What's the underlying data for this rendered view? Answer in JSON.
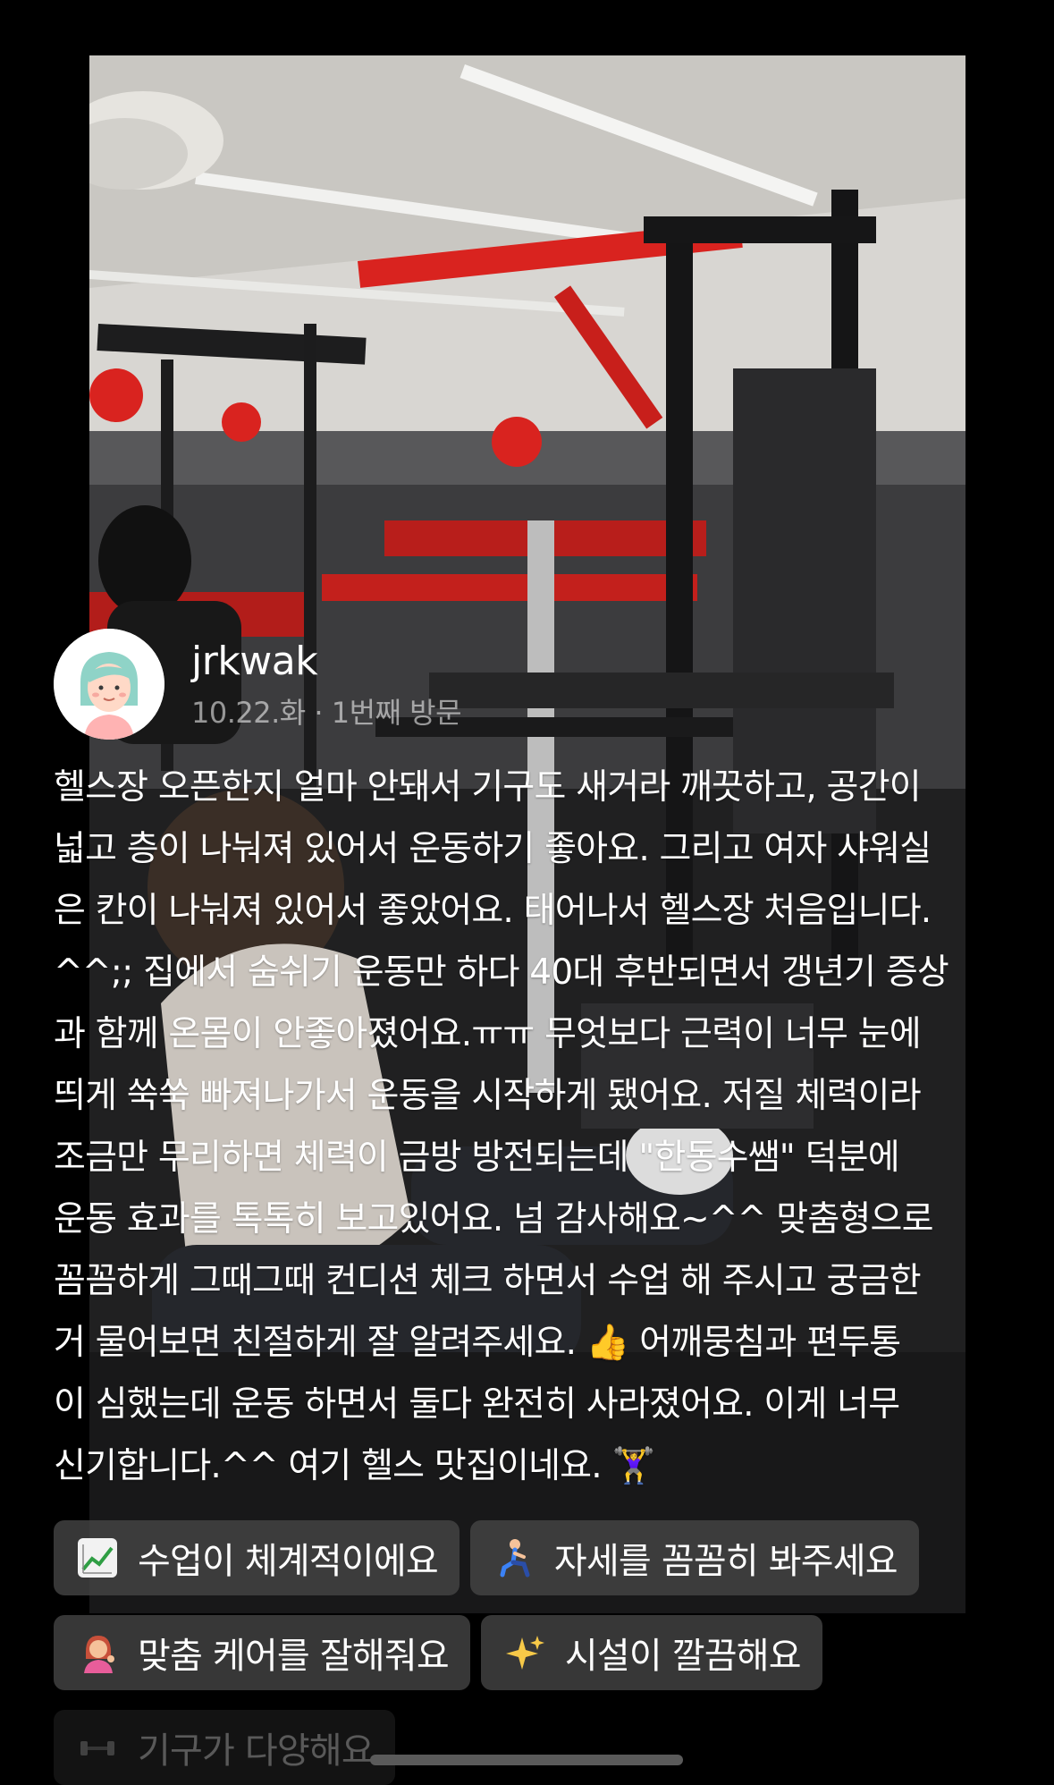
{
  "review": {
    "username": "jrkwak",
    "visit_date": "10.22.화",
    "visit_separator": " · ",
    "visit_count": "1번째 방문",
    "body": "헬스장 오픈한지 얼마 안돼서 기구도 새거라 깨끗하고, 공간이\n넓고 층이 나눠져 있어서 운동하기 좋아요. 그리고 여자 샤워실\n은 칸이 나눠져 있어서 좋았어요. 태어나서 헬스장 처음입니다.\n^^;; 집에서 숨쉬기 운동만 하다 40대 후반되면서 갱년기 증상\n과 함께 온몸이 안좋아졌어요.ㅠㅠ 무엇보다 근력이 너무 눈에\n띄게 쑥쑥 빠져나가서 운동을 시작하게 됐어요. 저질 체력이라\n조금만 무리하면 체력이 금방 방전되는데 \"한동수쌤\" 덕분에\n운동 효과를 톡톡히 보고있어요. 넘 감사해요~^^ 맞춤형으로\n꼼꼼하게 그때그때 컨디션 체크 하면서 수업 해 주시고 궁금한\n거 물어보면 친절하게 잘 알려주세요. 👍 어깨뭉침과 편두통\n이 심했는데 운동 하면서 둘다 완전히 사라졌어요. 이게 너무\n신기합니다.^^ 여기 헬스 맛집이네요. 🏋️‍♀️",
    "avatar_icon": "avatar-illustration-icon"
  },
  "tags": [
    {
      "icon": "chart-increasing-icon",
      "emoji": "📈",
      "label": "수업이 체계적이에요"
    },
    {
      "icon": "person-lunging-icon",
      "emoji": "🧎",
      "label": "자세를 꼼꼼히 봐주세요"
    },
    {
      "icon": "person-tipping-hand-icon",
      "emoji": "💁",
      "label": "맞춤 케어를 잘해줘요"
    },
    {
      "icon": "sparkles-icon",
      "emoji": "✨",
      "label": "시설이 깔끔해요"
    },
    {
      "icon": "dumbbell-icon",
      "emoji": "🏋",
      "label": "기구가 다양해요"
    }
  ],
  "colors": {
    "background": "#000000",
    "tag_background": "#464646",
    "secondary_text": "#9a9a9a",
    "avatar_face": "#ffd9c7",
    "avatar_hair": "#8fd3c7",
    "equipment_red": "#d9231f"
  }
}
